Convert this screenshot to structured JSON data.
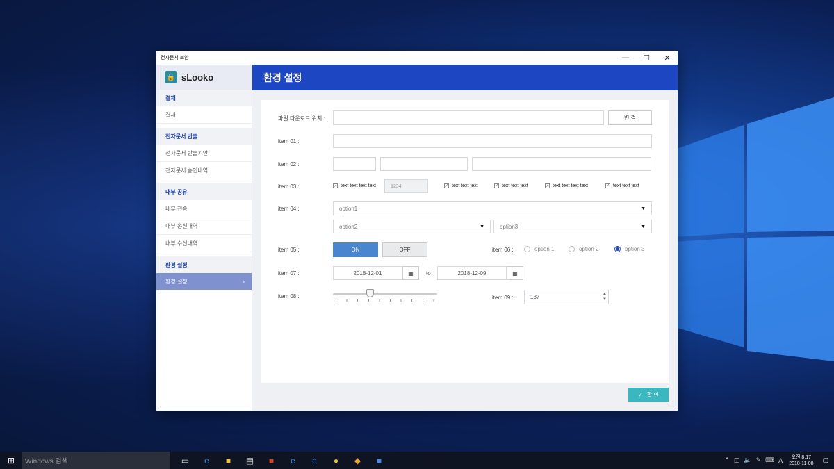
{
  "taskbar": {
    "search_placeholder": "Windows 검색",
    "icons": [
      "task-view-icon",
      "edge-icon",
      "file-explorer-icon",
      "store-icon",
      "powerpoint-icon",
      "ie-icon",
      "ie-icon",
      "chrome-icon",
      "app-icon",
      "doc-icon"
    ],
    "tray_lang": "A",
    "clock_time": "오전 8:17",
    "clock_date": "2018-11-08"
  },
  "window": {
    "title": "전자문서 보안",
    "brand": "sLooko"
  },
  "sidebar": {
    "sections": [
      {
        "title": "결재",
        "items": [
          "결재"
        ]
      },
      {
        "title": "전자문서 반출",
        "items": [
          "전자문서 반출기안",
          "전자문서 승인내역"
        ]
      },
      {
        "title": "내부 공유",
        "items": [
          "내부 전송",
          "내부 송신내역",
          "내부 수신내역"
        ]
      },
      {
        "title": "환경 설정",
        "items": [
          "환경 설정"
        ]
      }
    ],
    "active_item": "환경 설정"
  },
  "main": {
    "header": "환경 설정",
    "download_label": "파일 다운로드 위치 :",
    "download_value": "",
    "change_button": "변 경",
    "item01_label": "item 01 :",
    "item02_label": "item 02 :",
    "item03_label": "item 03 :",
    "item03_checks": [
      {
        "label": "text text text text",
        "checked": true
      },
      {
        "label": "text text text",
        "checked": true
      },
      {
        "label": "text text text",
        "checked": true
      },
      {
        "label": "text text text text",
        "checked": true
      },
      {
        "label": "text text text",
        "checked": true
      }
    ],
    "item03_input": "1234",
    "item04_label": "item 04 :",
    "item04_select1": "option1",
    "item04_select2": "option2",
    "item04_select3": "option3",
    "item05_label": "item 05 :",
    "toggle_on": "ON",
    "toggle_off": "OFF",
    "item06_label": "item 06 :",
    "item06_options": [
      "option 1",
      "option 2",
      "option 3"
    ],
    "item06_selected": "option 3",
    "item07_label": "item 07 :",
    "date_from": "2018-12-01",
    "date_to_label": "to",
    "date_to": "2018-12-09",
    "item08_label": "item 08 :",
    "slider_value": 0.35,
    "item09_label": "item 09 :",
    "item09_value": "137",
    "confirm_button": "확 인"
  },
  "colors": {
    "accent": "#1d46c2",
    "confirm": "#3bb7bf",
    "toggle_on": "#4a86cf",
    "sidebar_active": "#7f91cf"
  }
}
